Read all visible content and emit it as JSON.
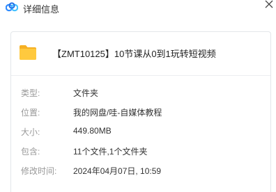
{
  "window": {
    "title": "详细信息",
    "logo_icon": "baidu-netdisk-cloud-icon",
    "close_icon": "close-icon"
  },
  "file": {
    "icon": "folder-icon",
    "name": "【ZMT10125】10节课从0到1玩转短视频"
  },
  "details": [
    {
      "label": "类型:",
      "value": "文件夹"
    },
    {
      "label": "位置:",
      "value": "我的网盘/哇-自媒体教程"
    },
    {
      "label": "大小:",
      "value": "449.80MB"
    },
    {
      "label": "包含:",
      "value": "11个文件,1个文件夹"
    },
    {
      "label": "修改时间:",
      "value": "2024年04月07日, 10:59"
    }
  ],
  "colors": {
    "accent_blue": "#2f8cff",
    "folder_yellow": "#ffc53a",
    "label_gray": "#999999"
  }
}
